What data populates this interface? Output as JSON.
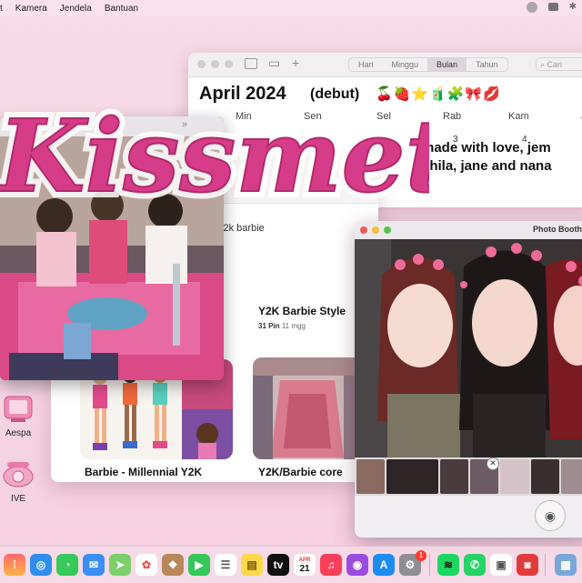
{
  "menubar": {
    "items": [
      "t",
      "Kamera",
      "Jendela",
      "Bantuan"
    ]
  },
  "calendar": {
    "views": [
      "Hari",
      "Minggu",
      "Bulan",
      "Tahun"
    ],
    "active_view": "Bulan",
    "search_placeholder": "Cari",
    "month_title": "April 2024",
    "subtitle": "(debut)",
    "emojis": "🍒🍓⭐🧃🧩🎀💋",
    "days": [
      "Min",
      "Sen",
      "Sel",
      "Rab",
      "Kam",
      "J"
    ],
    "dates": [
      "3",
      "4"
    ],
    "note_line1": "made with love, jem",
    "note_line2": "shila, jane and nana"
  },
  "pinterest": {
    "query": "y2k barbie",
    "cards": [
      {
        "title": "Y2K Barbie Style",
        "pins": "31 Pin",
        "age": "11 mgg"
      },
      {
        "title": "Barbie - Millennial Y2K"
      },
      {
        "title": "Y2K/Barbie core"
      }
    ]
  },
  "logo_text": "Kissmet",
  "photo_booth": {
    "title": "Photo Booth"
  },
  "desktop_icons": [
    {
      "label": "Aespa"
    },
    {
      "label": "IVE"
    }
  ],
  "dock": {
    "calendar_month": "APR",
    "calendar_day": "21",
    "badge": "1",
    "apps": [
      "launchpad-icon",
      "safari-icon",
      "messages-icon",
      "mail-icon",
      "maps-icon",
      "photos-icon",
      "notes-brown-icon",
      "facetime-icon",
      "reminders-icon",
      "notes-icon",
      "apple-tv-icon",
      "calendar-icon",
      "music-icon",
      "podcasts-icon",
      "app-store-icon",
      "system-settings-icon",
      "spotify-icon",
      "whatsapp-icon",
      "preview-icon",
      "photo-booth-icon",
      "desktop-folder-icon"
    ]
  }
}
